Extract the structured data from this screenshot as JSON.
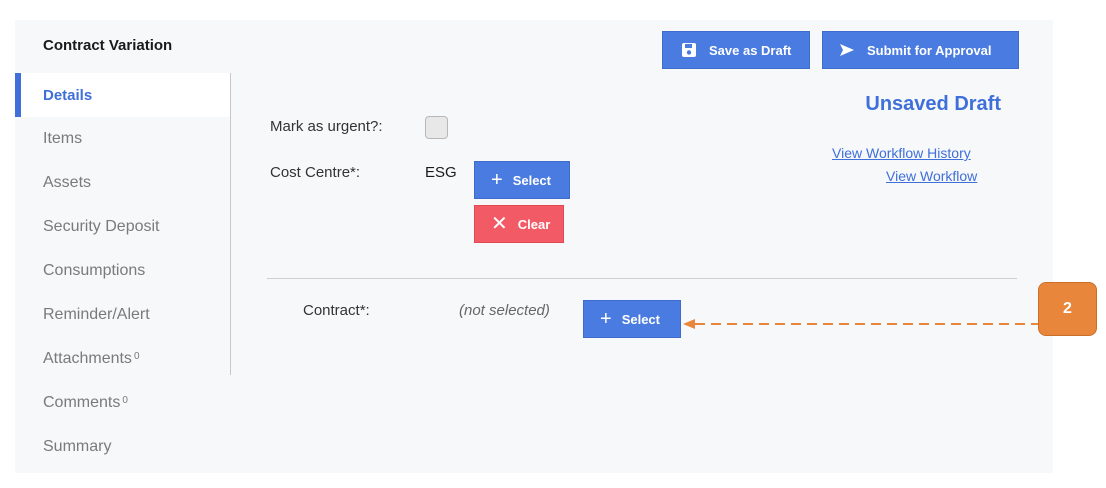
{
  "header": {
    "title": "Contract Variation",
    "save_draft_label": "Save as Draft",
    "submit_label": "Submit for Approval"
  },
  "sidebar": {
    "items": [
      {
        "label": "Details",
        "active": true
      },
      {
        "label": "Items"
      },
      {
        "label": "Assets"
      },
      {
        "label": "Security Deposit"
      },
      {
        "label": "Consumptions"
      },
      {
        "label": "Reminder/Alert"
      },
      {
        "label": "Attachments",
        "count": "0"
      },
      {
        "label": "Comments",
        "count": "0"
      },
      {
        "label": "Summary"
      }
    ]
  },
  "form": {
    "urgent_label": "Mark as urgent?:",
    "urgent_checked": false,
    "cost_centre_label": "Cost Centre*:",
    "cost_centre_value": "ESG",
    "select_label": "Select",
    "clear_label": "Clear",
    "contract_label": "Contract*:",
    "contract_value": "(not selected)",
    "contract_select_label": "Select"
  },
  "status": {
    "draft_status": "Unsaved Draft",
    "workflow_history_link": "View Workflow History",
    "workflow_link": "View Workflow"
  },
  "callout": {
    "number": "2"
  },
  "colors": {
    "accent": "#3f6fd9",
    "button_blue": "#4a7be0",
    "button_red": "#f25a66",
    "callout_orange": "#e8873b"
  }
}
